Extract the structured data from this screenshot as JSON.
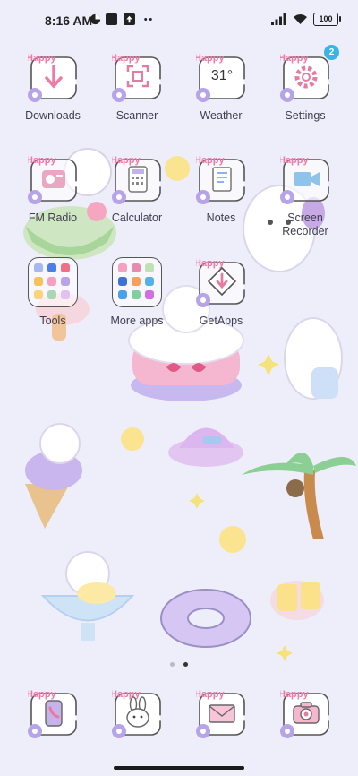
{
  "status_bar": {
    "time": "8:16 AM",
    "battery": "100"
  },
  "tile_tag": "Happy",
  "apps_row1": [
    {
      "label": "Downloads",
      "icon": "download-icon"
    },
    {
      "label": "Scanner",
      "icon": "scan-icon"
    },
    {
      "label": "Weather",
      "icon": "weather-icon",
      "temperature": "31°"
    },
    {
      "label": "Settings",
      "icon": "gear-icon",
      "badge": "2"
    }
  ],
  "apps_row2": [
    {
      "label": "FM Radio",
      "icon": "radio-icon"
    },
    {
      "label": "Calculator",
      "icon": "calculator-icon"
    },
    {
      "label": "Notes",
      "icon": "notes-icon"
    },
    {
      "label": "Screen Recorder",
      "icon": "video-camera-icon"
    }
  ],
  "apps_row3": [
    {
      "label": "Tools",
      "icon": "folder-icon"
    },
    {
      "label": "More apps",
      "icon": "folder-icon"
    },
    {
      "label": "GetApps",
      "icon": "getapps-icon"
    }
  ],
  "dock": [
    {
      "icon": "phone-icon"
    },
    {
      "icon": "messages-bunny-icon"
    },
    {
      "icon": "mail-icon"
    },
    {
      "icon": "camera-icon"
    }
  ],
  "page_indicator": {
    "pages": 2,
    "current": 2
  },
  "colors": {
    "background": "#eeeefb",
    "accent_pink": "#f07aa6",
    "badge_blue": "#38b4e8",
    "tile_outline": "#555555"
  }
}
